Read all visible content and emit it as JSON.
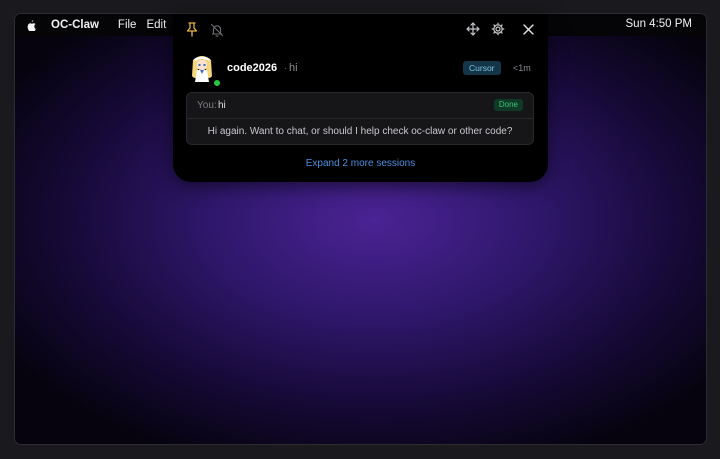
{
  "menubar": {
    "app_name": "OC-Claw",
    "menus": [
      "File",
      "Edit"
    ],
    "clock": "Sun 4:50 PM"
  },
  "panel": {
    "toolbar_icons": [
      "pin-icon",
      "bell-muted-icon",
      "move-icon",
      "gear-icon",
      "close-icon"
    ],
    "session": {
      "name": "code2026",
      "separator": "·",
      "preview": "hi",
      "badge": "Cursor",
      "time": "<1m",
      "online": true
    },
    "card": {
      "you_prefix": "You:",
      "you_text": "hi",
      "status": "Done",
      "reply": "Hi again. Want to chat, or should I help check oc-claw or other code?"
    },
    "expand_label": "Expand 2 more sessions"
  },
  "colors": {
    "pin": "#e3b341",
    "badge_cursor_bg": "#143448",
    "badge_done_bg": "#0f3a26",
    "link": "#4a8fe0",
    "online": "#27c93f"
  }
}
